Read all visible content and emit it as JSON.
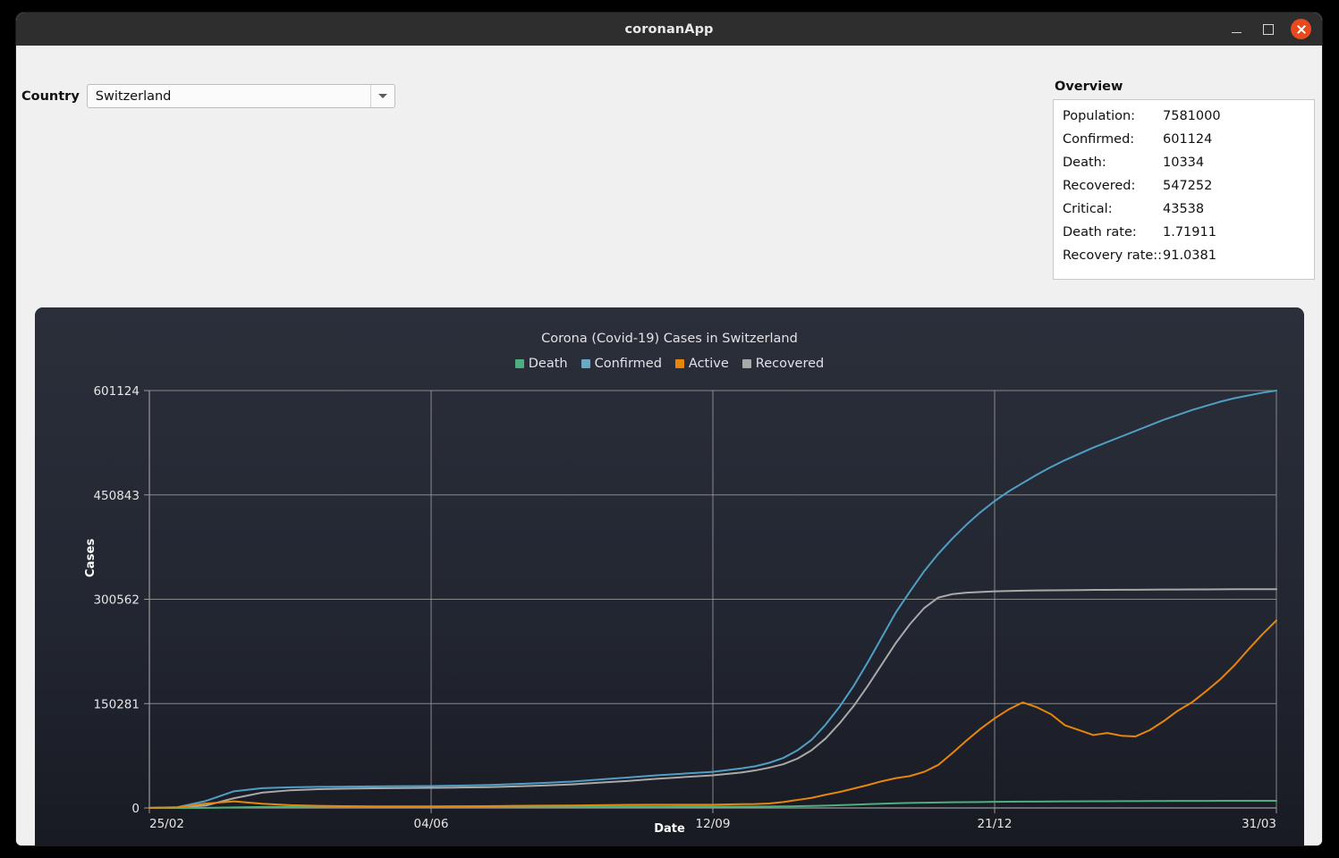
{
  "window": {
    "title": "coronanApp",
    "controls": {
      "minimize": "minimize",
      "maximize": "maximize",
      "close": "close"
    }
  },
  "controls": {
    "country_label": "Country",
    "country_value": "Switzerland",
    "country_options": [
      "Switzerland"
    ]
  },
  "overview": {
    "title": "Overview",
    "rows": [
      {
        "key": "Population:",
        "value": "7581000"
      },
      {
        "key": "Confirmed:",
        "value": "601124"
      },
      {
        "key": "Death:",
        "value": "10334"
      },
      {
        "key": "Recovered:",
        "value": "547252"
      },
      {
        "key": "Critical:",
        "value": "43538"
      },
      {
        "key": "Death rate:",
        "value": "1.71911"
      },
      {
        "key": "Recovery rate::",
        "value": "91.0381"
      }
    ]
  },
  "colors": {
    "death": "#4caf7d",
    "confirmed": "#4f9fc4",
    "active": "#e8860c",
    "recovered": "#a9a9a9",
    "panel_bg": "#282c37",
    "grid": "#9a9a9a",
    "close_button": "#e8491d",
    "titlebar": "#2e2e2e",
    "window_bg": "#f0f0f0"
  },
  "chart_data": {
    "type": "line",
    "title": "Corona (Covid-19) Cases in Switzerland",
    "xlabel": "Date",
    "ylabel": "Cases",
    "grid": true,
    "legend_position": "top-center",
    "ylim": [
      0,
      601124
    ],
    "yticks": [
      0,
      150281,
      300562,
      450843,
      601124
    ],
    "ytick_labels": [
      "0",
      "150281",
      "300562",
      "450843",
      "601124"
    ],
    "xticks": [
      0,
      100,
      200,
      300,
      400
    ],
    "xtick_labels": [
      "25/02",
      "04/06",
      "12/09",
      "21/12",
      "31/03"
    ],
    "x_unit": "days since 25/02",
    "x": [
      0,
      10,
      20,
      30,
      40,
      50,
      60,
      70,
      80,
      90,
      100,
      110,
      120,
      130,
      140,
      150,
      160,
      170,
      180,
      190,
      200,
      210,
      215,
      220,
      225,
      230,
      235,
      240,
      245,
      250,
      255,
      260,
      265,
      270,
      275,
      280,
      285,
      290,
      295,
      300,
      305,
      310,
      315,
      320,
      325,
      330,
      335,
      340,
      345,
      350,
      355,
      360,
      365,
      370,
      375,
      380,
      385,
      390,
      395,
      400
    ],
    "series": [
      {
        "name": "Confirmed",
        "color": "#4f9fc4",
        "values": [
          200,
          1200,
          10000,
          24000,
          28500,
          29800,
          30400,
          30700,
          31000,
          31300,
          31600,
          32200,
          33000,
          34500,
          36000,
          38000,
          41000,
          44000,
          47000,
          49500,
          52000,
          57000,
          60000,
          65000,
          72000,
          83000,
          98000,
          120000,
          146000,
          176000,
          210000,
          246000,
          282000,
          312000,
          341000,
          366000,
          388000,
          408000,
          426000,
          442000,
          456000,
          468000,
          480000,
          491000,
          501000,
          510000,
          519000,
          527000,
          535000,
          543000,
          551000,
          559000,
          566000,
          573000,
          579000,
          585000,
          590000,
          594000,
          598000,
          601124
        ]
      },
      {
        "name": "Recovered",
        "color": "#a9a9a9",
        "values": [
          50,
          400,
          3500,
          14000,
          22000,
          25500,
          27000,
          27800,
          28300,
          28700,
          29000,
          29400,
          30000,
          31000,
          32300,
          34000,
          36500,
          39000,
          42000,
          44500,
          47000,
          51000,
          54000,
          58000,
          63000,
          71000,
          83000,
          100000,
          122000,
          147000,
          176000,
          207000,
          238000,
          265000,
          288000,
          303000,
          308000,
          310000,
          311000,
          312000,
          312500,
          313000,
          313200,
          313400,
          313600,
          313800,
          314000,
          314100,
          314200,
          314300,
          314400,
          314500,
          314600,
          314700,
          314800,
          314900,
          315000,
          315000,
          315000,
          315000
        ]
      },
      {
        "name": "Active",
        "color": "#e8860c",
        "values": [
          150,
          800,
          6300,
          9500,
          6100,
          4000,
          3100,
          2500,
          2300,
          2200,
          2200,
          2400,
          2600,
          3000,
          3300,
          3600,
          4100,
          4500,
          4600,
          4600,
          4700,
          5500,
          5700,
          6500,
          8500,
          11500,
          14500,
          19000,
          23000,
          28000,
          33000,
          38500,
          43000,
          46000,
          52000,
          62000,
          79000,
          97000,
          114000,
          129000,
          142000,
          152000,
          145000,
          135000,
          119000,
          112000,
          105000,
          108000,
          104000,
          103000,
          112000,
          125000,
          140000,
          152000,
          168000,
          185000,
          205000,
          228000,
          250000,
          270000
        ]
      },
      {
        "name": "Death",
        "color": "#4caf7d",
        "values": [
          5,
          30,
          200,
          800,
          1400,
          1600,
          1650,
          1680,
          1700,
          1710,
          1720,
          1730,
          1740,
          1750,
          1760,
          1780,
          1800,
          1820,
          1840,
          1860,
          1900,
          1950,
          2000,
          2100,
          2250,
          2500,
          2900,
          3400,
          4000,
          4700,
          5400,
          6100,
          6700,
          7200,
          7600,
          7900,
          8200,
          8400,
          8600,
          8800,
          8950,
          9100,
          9250,
          9380,
          9480,
          9560,
          9640,
          9720,
          9790,
          9860,
          9930,
          10000,
          10060,
          10120,
          10180,
          10230,
          10270,
          10300,
          10320,
          10334
        ]
      }
    ]
  }
}
